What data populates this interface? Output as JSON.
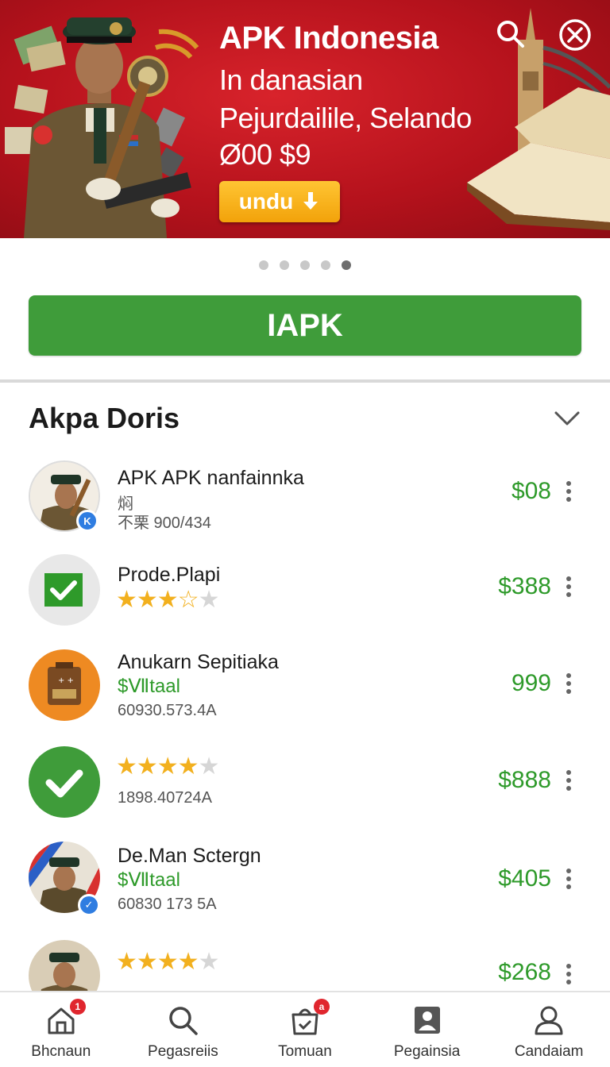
{
  "banner": {
    "title": "APK Indonesia",
    "line1": "In danasian",
    "line2": "Pejurdailile, Selando",
    "line3": "Ø00 $9",
    "button_label": "undu",
    "search_icon": "search-icon",
    "close_icon": "close-icon",
    "accent": "#c8141e"
  },
  "carousel": {
    "count": 5,
    "active_index": 4
  },
  "main_button": {
    "label": "IAPK",
    "color": "#3f9c3a"
  },
  "section": {
    "title": "Akpa Doris"
  },
  "items": [
    {
      "title": "APK APK nanfainnka",
      "line2": "焖",
      "line3": "不栗 900/434",
      "price": "$08"
    },
    {
      "title": "Prode.Plapi",
      "rating": 3.5,
      "price": "$388"
    },
    {
      "title": "Anukarn Sepitiaka",
      "green": "$Ⅶtaal",
      "line3": "60930.573.4A",
      "price": "999"
    },
    {
      "title": "",
      "rating": 3.5,
      "line3": "1898.40724A",
      "price": "$888"
    },
    {
      "title": "De.Man Sctergn",
      "green": "$Ⅶtaal",
      "line3": "60830 173 5A",
      "price": "$405"
    },
    {
      "title": "",
      "rating": 3.5,
      "price": "$268"
    }
  ],
  "nav": [
    {
      "label": "Bhcnaun",
      "icon": "home-icon",
      "badge": "1"
    },
    {
      "label": "Pegasreiis",
      "icon": "search-icon",
      "badge": ""
    },
    {
      "label": "Tomuan",
      "icon": "store-icon",
      "badge": "a"
    },
    {
      "label": "Pegainsia",
      "icon": "image-icon",
      "badge": ""
    },
    {
      "label": "Candaiam",
      "icon": "person-icon",
      "badge": ""
    }
  ],
  "colors": {
    "price_green": "#2e9a2a",
    "star": "#f2b01e",
    "badge_blue": "#2f7de1"
  }
}
